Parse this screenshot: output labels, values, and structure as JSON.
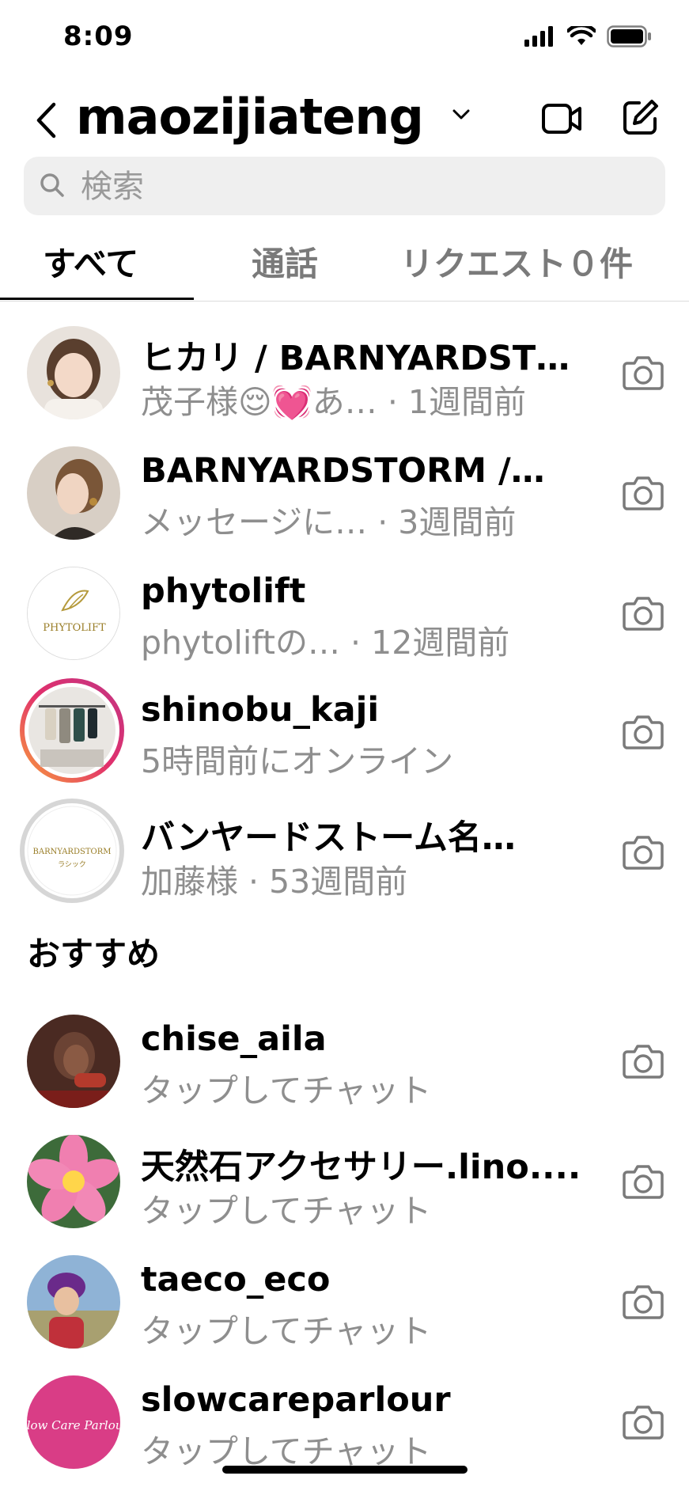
{
  "status_bar": {
    "time": "8:09"
  },
  "header": {
    "account_name": "maozijiateng"
  },
  "search": {
    "placeholder": "検索"
  },
  "tabs": [
    {
      "label": "すべて"
    },
    {
      "label": "通話"
    },
    {
      "label": "リクエスト０件"
    }
  ],
  "threads": [
    {
      "name": "ヒカリ / BARNYARDST…",
      "preview": "茂子様😌💓あ… · 1週間前"
    },
    {
      "name": "BARNYARDSTORM /…",
      "preview": "メッセージに… · 3週間前"
    },
    {
      "name": "phytolift",
      "preview": "phytoliftの… · 12週間前",
      "avatar_text": "PHYTOLIFT"
    },
    {
      "name": "shinobu_kaji",
      "preview": "5時間前にオンライン"
    },
    {
      "name": "バンヤードストーム名…",
      "preview": "加藤様 · 53週間前",
      "avatar_text": "BARNYARDSTORM",
      "avatar_subtext": "ラシック"
    }
  ],
  "suggested": {
    "title": "おすすめ",
    "items": [
      {
        "name": "chise_aila",
        "preview": "タップしてチャット"
      },
      {
        "name": "天然石アクセサリー.lino....",
        "preview": "タップしてチャット"
      },
      {
        "name": "taeco_eco",
        "preview": "タップしてチャット"
      },
      {
        "name": "slowcareparlour",
        "preview": "タップしてチャット",
        "avatar_text": "Slow Care Parlour"
      }
    ]
  },
  "colors": {
    "secondary_text": "#8e8e8e",
    "search_bg": "#efefef",
    "story_ring": "#d6249f"
  }
}
